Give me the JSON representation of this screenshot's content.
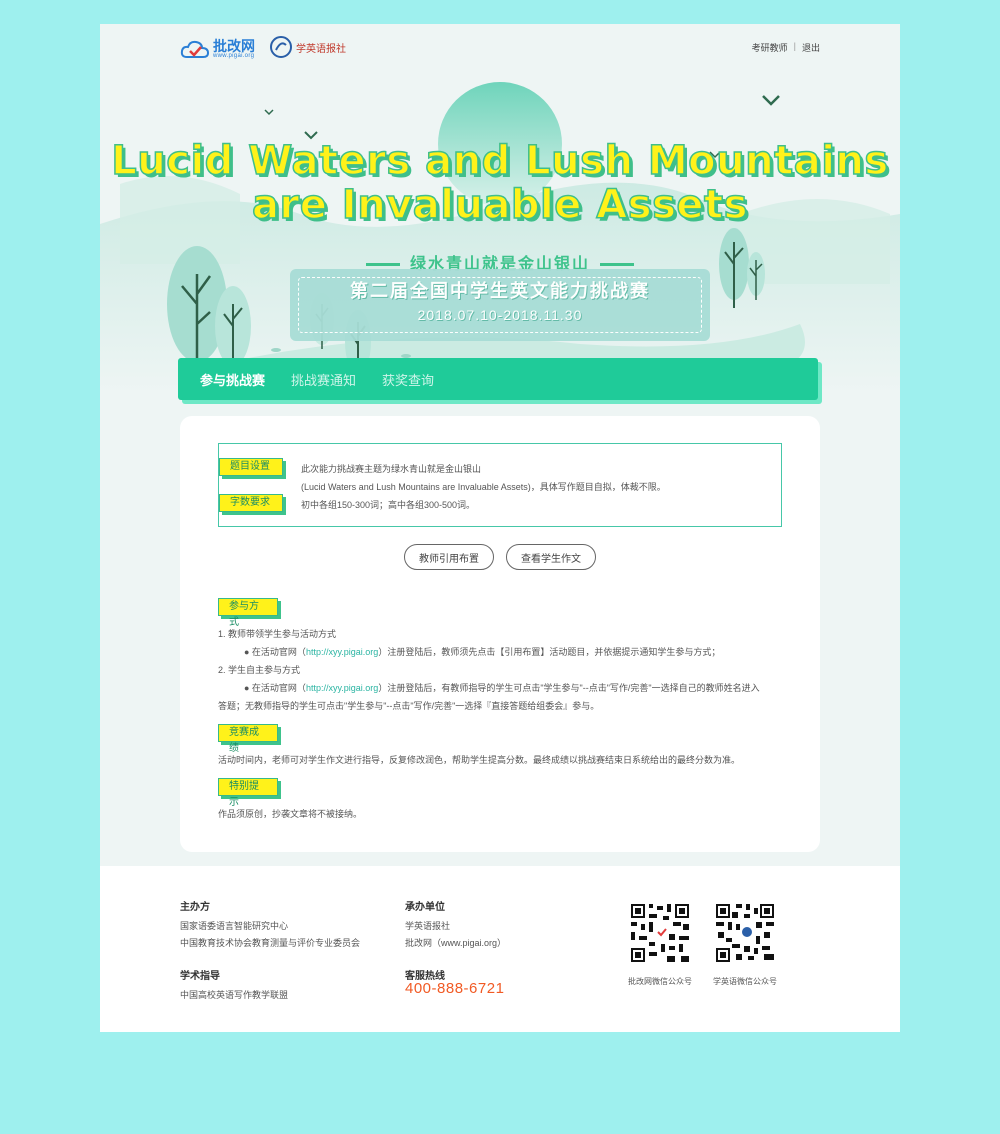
{
  "header": {
    "logo_pigai": "批改网",
    "logo_pigai_sub": "www.pigai.org",
    "logo_xyy": "学英语报社",
    "user_role": "考研教师",
    "logout": "退出"
  },
  "banner": {
    "title_line1": "Lucid Waters and Lush Mountains",
    "title_line2": "are Invaluable Assets",
    "slogan": "绿水青山就是金山银山",
    "contest_name": "第二届全国中学生英文能力挑战赛",
    "contest_date": "2018.07.10-2018.11.30"
  },
  "nav": {
    "items": [
      "参与挑战赛",
      "挑战赛通知",
      "获奖查询"
    ]
  },
  "topic": {
    "tag_topic": "题目设置",
    "tag_words": "字数要求",
    "line1": "此次能力挑战赛主题为绿水青山就是金山银山",
    "line2": "(Lucid Waters and Lush Mountains are Invaluable Assets)，具体写作题目自拟，体裁不限。",
    "line3": "初中各组150-300词；高中各组300-500词。"
  },
  "buttons": {
    "teacher_assign": "教师引用布置",
    "view_student": "查看学生作文"
  },
  "participation": {
    "tag": "参与方式",
    "item1": "1. 教师带领学生参与活动方式",
    "item1_pre": "● 在活动官网（",
    "item1_link": "http://xyy.pigai.org",
    "item1_post": "）注册登陆后，教师须先点击【引用布置】活动题目，并依据提示通知学生参与方式；",
    "item2": "2. 学生自主参与方式",
    "item2_pre": "● 在活动官网（",
    "item2_link": "http://xyy.pigai.org",
    "item2_post": "）注册登陆后，有教师指导的学生可点击\"学生参与\"--点击\"写作/完善\"一选择自己的教师姓名进入",
    "item2_cont": "答题；无教师指导的学生可点击\"学生参与\"--点击\"写作/完善\"一选择『直接答题给组委会』参与。"
  },
  "results": {
    "tag": "竞赛成绩",
    "text": "活动时间内，老师可对学生作文进行指导，反复修改润色，帮助学生提高分数。最终成绩以挑战赛结束日系统给出的最终分数为准。"
  },
  "notice": {
    "tag": "特别提示",
    "text": "作品须原创，抄袭文章将不被接纳。"
  },
  "footer": {
    "organizer_title": "主办方",
    "organizer_1": "国家语委语言智能研究中心",
    "organizer_2": "中国教育技术协会教育测量与评价专业委员会",
    "academic_title": "学术指导",
    "academic_1": "中国高校英语写作教学联盟",
    "undertaker_title": "承办单位",
    "undertaker_1": "学英语报社",
    "undertaker_2": "批改网（www.pigai.org）",
    "hotline_title": "客服热线",
    "hotline": "400-888-6721",
    "qr1_caption": "批改网微信公众号",
    "qr2_caption": "学英语微信公众号"
  },
  "colors": {
    "page_bg": "#9ef0ee",
    "nav_green": "#1fcb99",
    "tag_yellow": "#fff21a",
    "hotline_orange": "#f15a24"
  }
}
